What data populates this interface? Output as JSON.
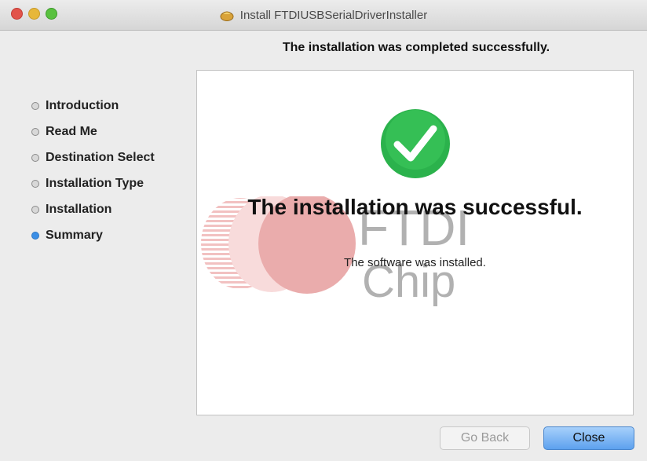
{
  "window": {
    "title": "Install FTDIUSBSerialDriverInstaller"
  },
  "header": {
    "subtitle": "The installation was completed successfully."
  },
  "sidebar": {
    "steps": [
      {
        "label": "Introduction",
        "active": false
      },
      {
        "label": "Read Me",
        "active": false
      },
      {
        "label": "Destination Select",
        "active": false
      },
      {
        "label": "Installation Type",
        "active": false
      },
      {
        "label": "Installation",
        "active": false
      },
      {
        "label": "Summary",
        "active": true
      }
    ]
  },
  "content": {
    "title": "The installation was successful.",
    "message": "The software was installed.",
    "watermark": "FTDI Chip"
  },
  "buttons": {
    "back": "Go Back",
    "close": "Close"
  },
  "colors": {
    "accent": "#3a8ee6",
    "success": "#2bb24c",
    "ftdi_red": "#d24a4a"
  }
}
